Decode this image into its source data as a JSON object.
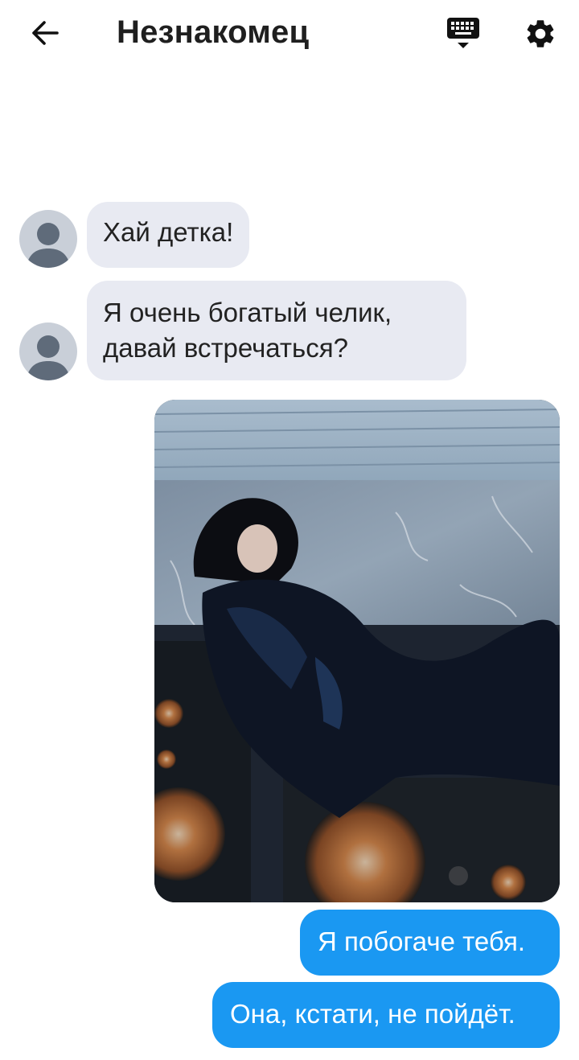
{
  "header": {
    "title": "Незнакомец",
    "back_icon": "arrow-left-icon",
    "keyboard_icon": "keyboard-icon",
    "settings_icon": "gear-icon"
  },
  "messages": {
    "incoming": [
      {
        "text": "Хай детка!"
      },
      {
        "text": "Я очень богатый челик, давай встречаться?"
      }
    ],
    "outgoing": [
      {
        "text": "Я побогаче тебя."
      },
      {
        "text": "Она, кстати, не пойдёт."
      }
    ],
    "photo": {
      "type": "image",
      "subject": "person-on-speakers"
    }
  },
  "colors": {
    "incoming_bubble": "#e8eaf2",
    "outgoing_bubble": "#1a98f2",
    "avatar_bg": "#c9cfd8"
  }
}
